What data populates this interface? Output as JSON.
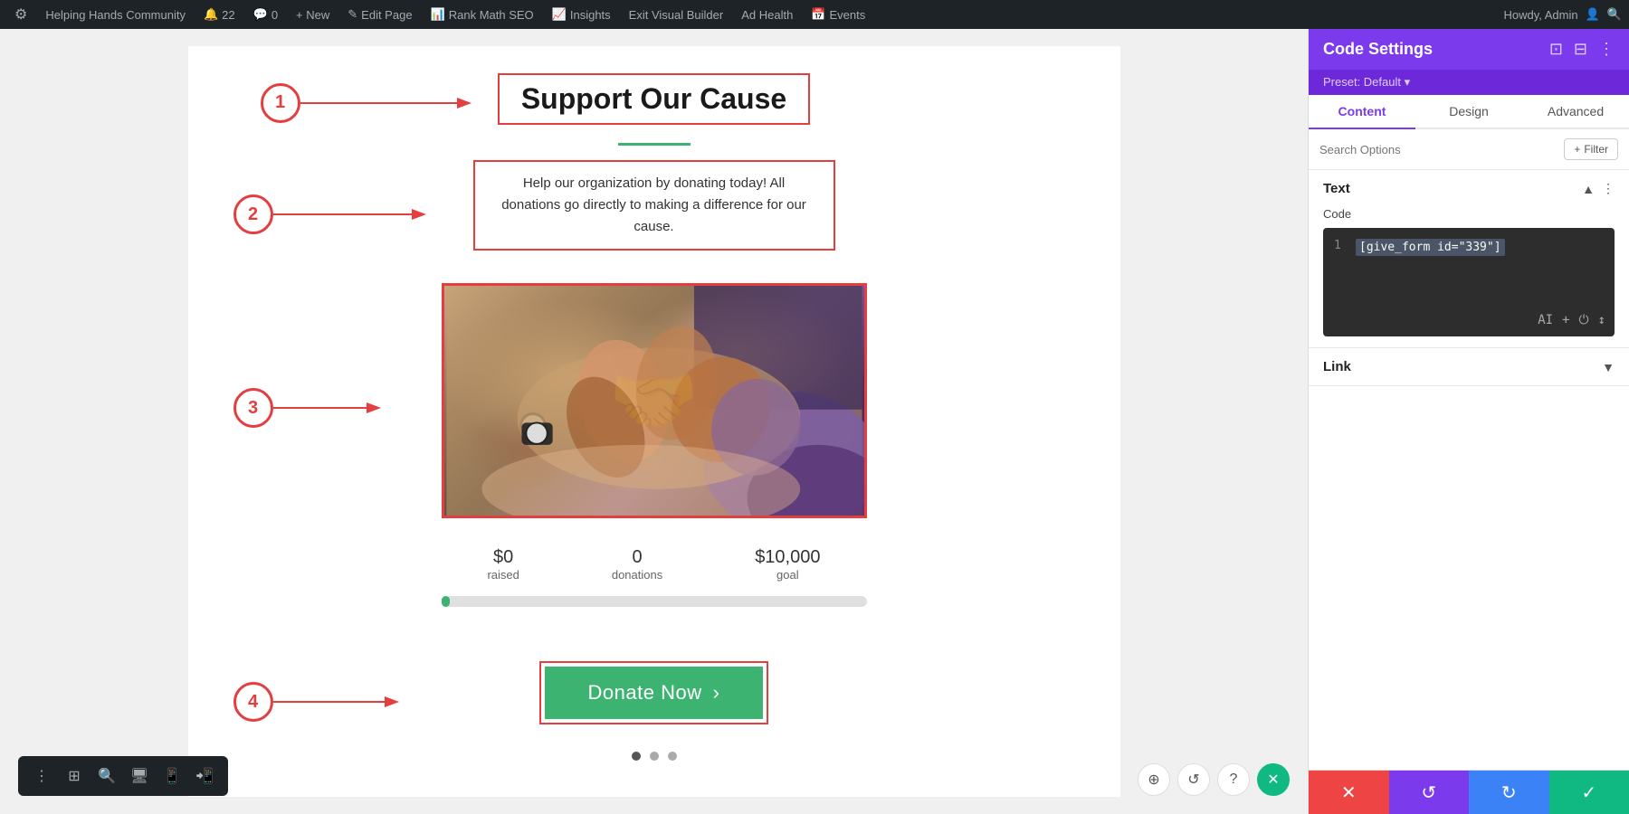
{
  "adminBar": {
    "logo": "⚙",
    "siteName": "Helping Hands Community",
    "updates": "22",
    "comments": "0",
    "newLabel": "+ New",
    "editPage": "Edit Page",
    "rankMath": "Rank Math SEO",
    "insights": "Insights",
    "exitBuilder": "Exit Visual Builder",
    "adHealth": "Ad Health",
    "events": "Events",
    "howdy": "Howdy, Admin"
  },
  "canvas": {
    "title": "Support Our Cause",
    "description": "Help our organization by donating today! All donations go directly to making a difference for our cause.",
    "stats": [
      {
        "value": "$0",
        "label": "raised"
      },
      {
        "value": "0",
        "label": "donations"
      },
      {
        "value": "$10,000",
        "label": "goal"
      }
    ],
    "donateBtnLabel": "Donate Now",
    "donateBtnArrow": "›"
  },
  "panel": {
    "title": "Code Settings",
    "presetLabel": "Preset: Default ▾",
    "tabs": [
      {
        "label": "Content",
        "active": true
      },
      {
        "label": "Design",
        "active": false
      },
      {
        "label": "Advanced",
        "active": false
      }
    ],
    "searchPlaceholder": "Search Options",
    "filterLabel": "+ Filter",
    "textSectionLabel": "Text",
    "codeSectionLabel": "Code",
    "codeValue": "[give_form id=\"339\"]",
    "codeLineNum": "1",
    "linkLabel": "Link",
    "actionButtons": {
      "cancel": "✕",
      "undo": "↺",
      "redo": "↻",
      "save": "✓"
    }
  },
  "annotations": [
    {
      "number": "1",
      "target": "title"
    },
    {
      "number": "2",
      "target": "description"
    },
    {
      "number": "3",
      "target": "image"
    },
    {
      "number": "4",
      "target": "donate-button"
    }
  ],
  "bottomToolbar": {
    "tools": [
      "⋮",
      "⊞",
      "🔍",
      "🖥",
      "📱",
      "📲"
    ]
  },
  "bottomRightIcons": {
    "icons": [
      "⊕",
      "↺",
      "?"
    ],
    "closeIcon": "✕"
  }
}
